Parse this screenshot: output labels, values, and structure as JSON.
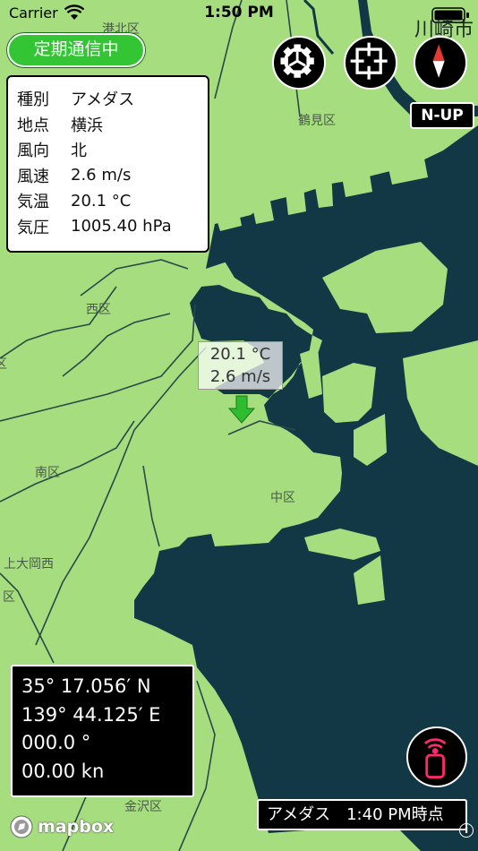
{
  "status_bar": {
    "carrier": "Carrier",
    "time": "1:50 PM"
  },
  "map": {
    "land_color": "#a6de7f",
    "water_color": "#123845",
    "road_color": "#2a4a49",
    "labels": {
      "tsurumi": "鶴見区",
      "nishi": "西区",
      "minami": "南区",
      "naka": "中区",
      "kamiooka": "上大岡西",
      "kanazawa": "金沢区",
      "ku1": "区",
      "ku2": "区",
      "konan_partial": "港北区",
      "kawasaki": "川崎市"
    }
  },
  "comm_button": {
    "label": "定期通信中",
    "color": "#34c534"
  },
  "info_panel": {
    "rows": [
      {
        "key": "種別",
        "value": "アメダス"
      },
      {
        "key": "地点",
        "value": "横浜"
      },
      {
        "key": "風向",
        "value": "北"
      },
      {
        "key": "風速",
        "value": "2.6 m/s"
      },
      {
        "key": "気温",
        "value": "20.1 °C"
      },
      {
        "key": "気圧",
        "value": "1005.40 hPa"
      }
    ]
  },
  "buttons": {
    "settings_icon": "gear-icon",
    "locate_icon": "crosshair-icon",
    "compass_icon": "compass-icon",
    "orientation": "N-UP",
    "remote_icon": "signal-phone-icon"
  },
  "observation_marker": {
    "temperature": "20.1 °C",
    "wind_speed": "2.6 m/s",
    "arrow_color": "#2ebd2e"
  },
  "coordinates": {
    "latitude": "35° 17.056′ N",
    "longitude": "139° 44.125′ E",
    "heading": "000.0 °",
    "speed": "00.00 kn"
  },
  "caption": "アメダス　1:40 PM時点",
  "attribution": {
    "logo_text": "mapbox",
    "info": "i"
  }
}
